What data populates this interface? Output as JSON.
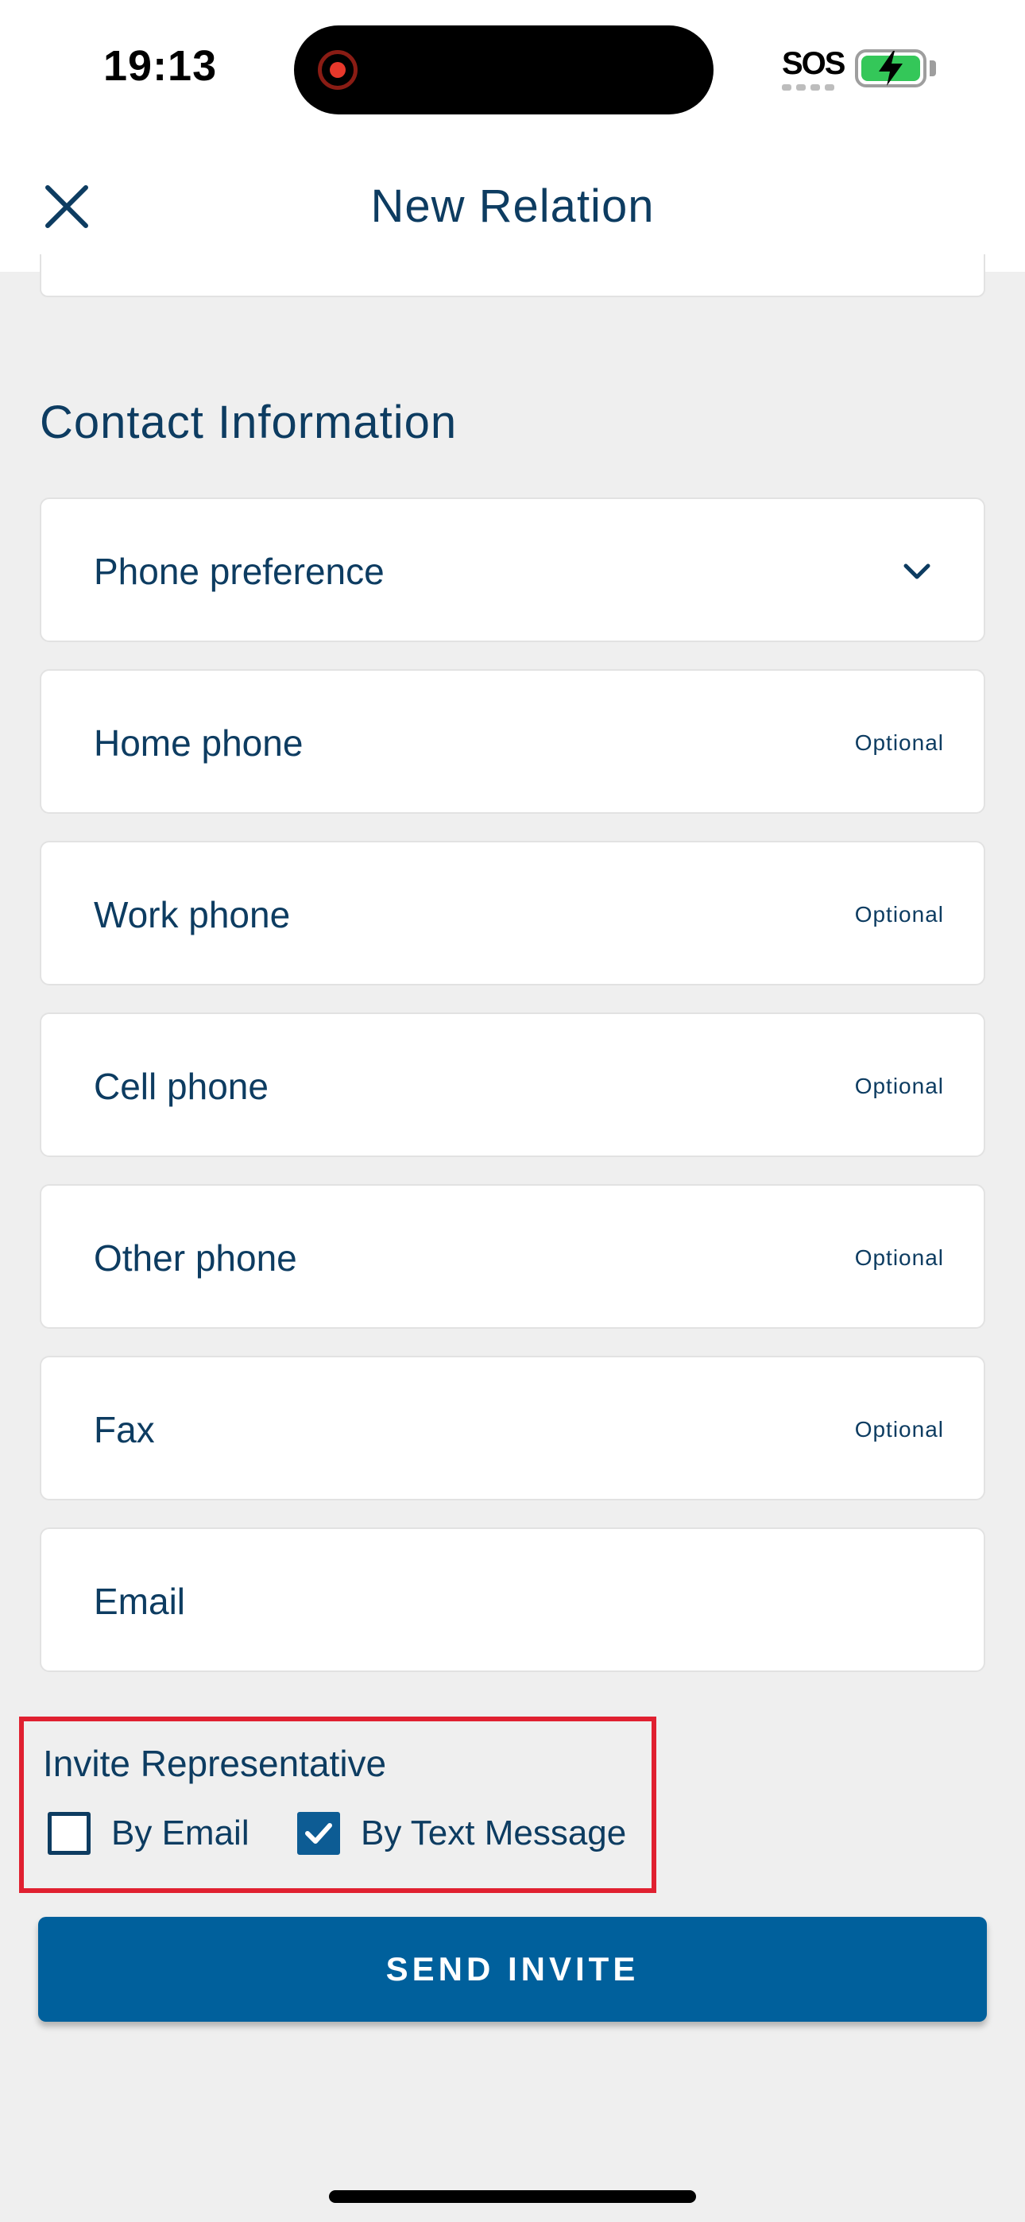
{
  "status_bar": {
    "time": "19:13",
    "sos": "SOS",
    "battery_color": "#34c759"
  },
  "header": {
    "title": "New Relation",
    "close_icon": "close-icon"
  },
  "section": {
    "title": "Contact Information"
  },
  "fields": {
    "phone_preference": {
      "label": "Phone preference",
      "icon": "chevron-down-icon"
    },
    "home_phone": {
      "label": "Home phone",
      "optional": "Optional"
    },
    "work_phone": {
      "label": "Work phone",
      "optional": "Optional"
    },
    "cell_phone": {
      "label": "Cell phone",
      "optional": "Optional"
    },
    "other_phone": {
      "label": "Other phone",
      "optional": "Optional"
    },
    "fax": {
      "label": "Fax",
      "optional": "Optional"
    },
    "email": {
      "label": "Email"
    }
  },
  "invite": {
    "title": "Invite Representative",
    "by_email": {
      "label": "By Email",
      "checked": false
    },
    "by_text": {
      "label": "By Text Message",
      "checked": true
    },
    "highlight_color": "#e02030"
  },
  "send_button": {
    "label": "SEND INVITE",
    "color": "#00609c"
  },
  "colors": {
    "text_primary": "#0d3c61",
    "background": "#efefef"
  }
}
